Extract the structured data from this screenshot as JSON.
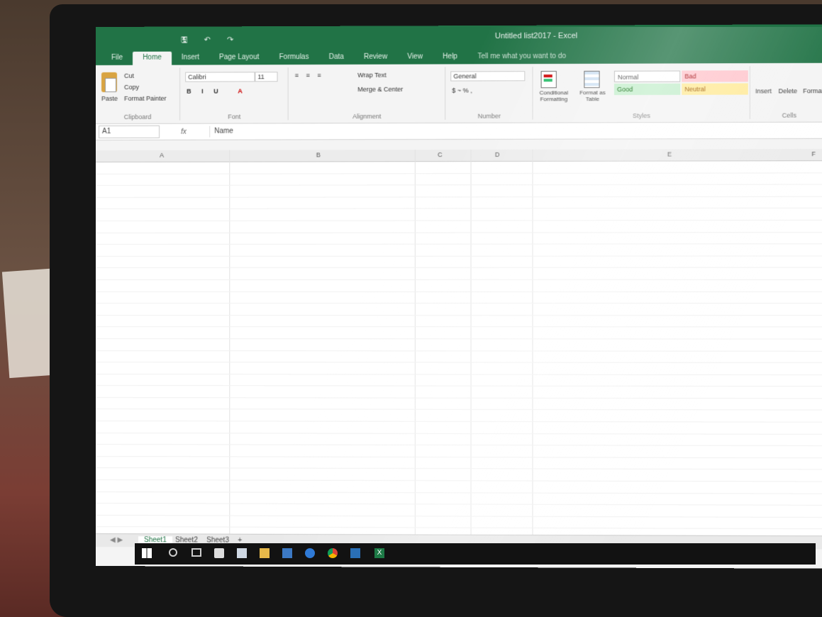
{
  "window": {
    "title": "Untitled list2017 - Excel"
  },
  "ribbon": {
    "tabs": [
      "File",
      "Home",
      "Insert",
      "Page Layout",
      "Formulas",
      "Data",
      "Review",
      "View",
      "Help"
    ],
    "tell_me": "Tell me what you want to do",
    "clipboard": {
      "paste": "Paste",
      "cut": "Cut",
      "copy": "Copy",
      "format_painter": "Format Painter",
      "caption": "Clipboard"
    },
    "font": {
      "name": "Calibri",
      "size": "11",
      "caption": "Font"
    },
    "alignment": {
      "wrap": "Wrap Text",
      "merge": "Merge & Center",
      "caption": "Alignment"
    },
    "number": {
      "format": "General",
      "caption": "Number"
    },
    "styles": {
      "conditional": "Conditional Formatting",
      "format_table": "Format as Table",
      "normal": "Normal",
      "bad": "Bad",
      "good": "Good",
      "neutral": "Neutral",
      "caption": "Styles"
    },
    "cells": {
      "insert": "Insert",
      "delete": "Delete",
      "format": "Format",
      "caption": "Cells"
    }
  },
  "formula_bar": {
    "name_box": "A1",
    "fx": "fx",
    "value": "Name"
  },
  "columns": [
    "A",
    "B",
    "C",
    "D",
    "E",
    "F"
  ],
  "rows": [
    {
      "n": "",
      "a": "",
      "b": "",
      "c": "",
      "d": ""
    },
    {
      "n": "",
      "a": "",
      "b": "",
      "c": "",
      "d": ""
    },
    {
      "n": "",
      "a": "",
      "b": "",
      "c": "",
      "d": ""
    },
    {
      "n": "",
      "a": "",
      "b": "",
      "c": "",
      "d": ""
    },
    {
      "n": "",
      "a": "",
      "b": "",
      "c": "",
      "d": ""
    },
    {
      "n": "",
      "a": "",
      "b": "",
      "c": "",
      "d": ""
    },
    {
      "n": "",
      "a": "",
      "b": "",
      "c": "",
      "d": ""
    },
    {
      "n": "",
      "a": "",
      "b": "",
      "c": "",
      "d": ""
    },
    {
      "n": "",
      "a": "",
      "b": "",
      "c": "",
      "d": ""
    },
    {
      "n": "",
      "a": "",
      "b": "",
      "c": "",
      "d": ""
    },
    {
      "n": "",
      "a": "",
      "b": "",
      "c": "",
      "d": ""
    },
    {
      "n": "",
      "a": "",
      "b": "",
      "c": "",
      "d": ""
    },
    {
      "n": "",
      "a": "",
      "b": "",
      "c": "",
      "d": ""
    },
    {
      "n": "",
      "a": "",
      "b": "",
      "c": "",
      "d": ""
    },
    {
      "n": "",
      "a": "",
      "b": "",
      "c": "",
      "d": ""
    },
    {
      "n": "",
      "a": "",
      "b": "",
      "c": "",
      "d": ""
    },
    {
      "n": "",
      "a": "",
      "b": "",
      "c": "",
      "d": ""
    },
    {
      "n": "",
      "a": "",
      "b": "",
      "c": "",
      "d": ""
    },
    {
      "n": "",
      "a": "",
      "b": "",
      "c": "",
      "d": ""
    },
    {
      "n": "",
      "a": "",
      "b": "",
      "c": "",
      "d": ""
    },
    {
      "n": "",
      "a": "",
      "b": "",
      "c": "",
      "d": ""
    },
    {
      "n": "",
      "a": "",
      "b": "",
      "c": "",
      "d": ""
    },
    {
      "n": "",
      "a": "",
      "b": "",
      "c": "",
      "d": ""
    },
    {
      "n": "",
      "a": "",
      "b": "",
      "c": "",
      "d": ""
    },
    {
      "n": "",
      "a": "",
      "b": "",
      "c": "",
      "d": ""
    },
    {
      "n": "",
      "a": "",
      "b": "",
      "c": "",
      "d": ""
    },
    {
      "n": "",
      "a": "",
      "b": "",
      "c": "",
      "d": ""
    },
    {
      "n": "",
      "a": "",
      "b": "",
      "c": "",
      "d": ""
    },
    {
      "n": "",
      "a": "",
      "b": "",
      "c": "",
      "d": ""
    },
    {
      "n": "",
      "a": "",
      "b": "",
      "c": "",
      "d": ""
    },
    {
      "n": "",
      "a": "",
      "b": "",
      "c": "",
      "d": ""
    },
    {
      "n": "",
      "a": "",
      "b": "",
      "c": "",
      "d": ""
    },
    {
      "n": "",
      "a": "",
      "b": "",
      "c": "",
      "d": ""
    },
    {
      "n": "",
      "a": "",
      "b": "",
      "c": "",
      "d": ""
    }
  ],
  "sheets": [
    "Sheet1",
    "Sheet2",
    "Sheet3"
  ],
  "add_sheet": "+",
  "taskbar": {
    "icons": [
      "windows-start-icon",
      "search-icon",
      "task-view-icon",
      "store-icon",
      "mail-icon",
      "file-explorer-icon",
      "edge-icon",
      "chrome-icon",
      "media-icon",
      "excel-icon"
    ]
  },
  "colors": {
    "excel_green": "#217346",
    "bad_fill": "#ffc7ce",
    "good_fill": "#c6efce",
    "neutral_fill": "#ffeb9c"
  }
}
